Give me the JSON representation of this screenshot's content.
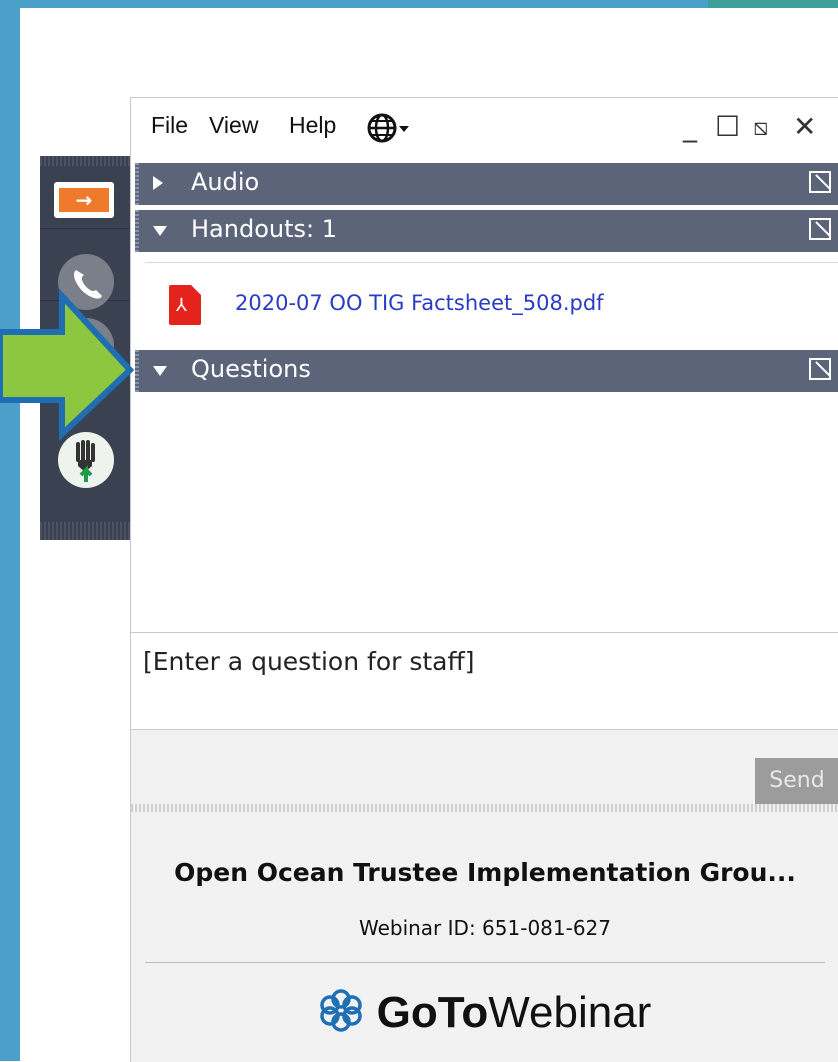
{
  "menu": {
    "file": "File",
    "view": "View",
    "help": "Help"
  },
  "window_controls": {
    "minimize": "_",
    "maximize": "☐",
    "restore": "⧅",
    "close": "✕"
  },
  "sections": {
    "audio": {
      "label": "Audio",
      "state": "collapsed"
    },
    "handouts": {
      "label": "Handouts: 1",
      "state": "expanded"
    },
    "questions": {
      "label": "Questions",
      "state": "expanded"
    }
  },
  "handout_file": {
    "name": "2020-07 OO TIG Factsheet_508.pdf",
    "icon": "pdf-icon"
  },
  "question_input": {
    "placeholder": "[Enter a question for staff]"
  },
  "send_button": {
    "label": "Send"
  },
  "footer": {
    "webinar_title": "Open Ocean Trustee Implementation Grou...",
    "webinar_id_label": "Webinar ID:",
    "webinar_id": "651-081-627",
    "logo_goto": "GoTo",
    "logo_webinar": "Webinar"
  },
  "sidebar_icons": [
    "expand-arrow-icon",
    "phone-icon",
    "question-icon",
    "raise-hand-icon"
  ],
  "colors": {
    "slide_border": "#4aa0c8",
    "section_header": "#5b6479",
    "sidebar": "#3a4150",
    "expand_accent": "#f07a2c",
    "pointer_arrow": "#8dc63f",
    "pointer_outline": "#1f6db3",
    "link": "#2a3cc4"
  }
}
